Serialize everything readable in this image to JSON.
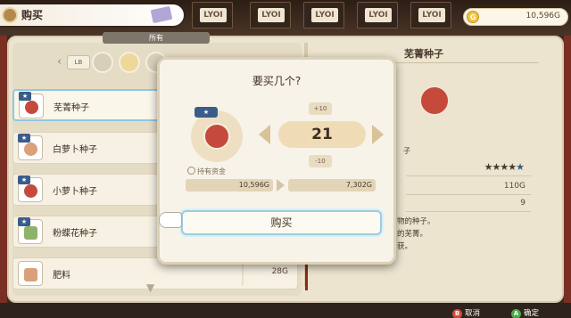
{
  "header": {
    "title": "购买"
  },
  "gold": {
    "amount": "10,596G",
    "coin_symbol": "G"
  },
  "shelf": {
    "labels": [
      "LYOI",
      "LYOI",
      "LYOI",
      "LYOI",
      "LYOI"
    ]
  },
  "category": {
    "label": "所有",
    "lb_label": "LB"
  },
  "items": [
    {
      "name": "芜菁种子",
      "price": ""
    },
    {
      "name": "白萝卜种子",
      "price": ""
    },
    {
      "name": "小萝卜种子",
      "price": ""
    },
    {
      "name": "粉蝶花种子",
      "price": ""
    },
    {
      "name": "肥料",
      "price": "28G"
    }
  ],
  "detail": {
    "title": "芜菁种子",
    "stat_label": "子",
    "rating": 4.5,
    "price": "110G",
    "count": "9",
    "desc_lines": [
      "物的种子。",
      "的芜菁。",
      "获。"
    ]
  },
  "dialog": {
    "title": "要买几个?",
    "quantity": "21",
    "step_up": "+10",
    "step_down": "-10",
    "funds_label": "持有资金",
    "funds_before": "10,596G",
    "funds_after": "7,302G",
    "buy_label": "购买"
  },
  "footer": {
    "cancel_key": "B",
    "cancel_label": "取消",
    "confirm_key": "A",
    "confirm_label": "确定"
  },
  "colors": {
    "selection": "#8cc9e3",
    "seed_sack": "#c54a3b",
    "gold": "#f3c33e"
  }
}
